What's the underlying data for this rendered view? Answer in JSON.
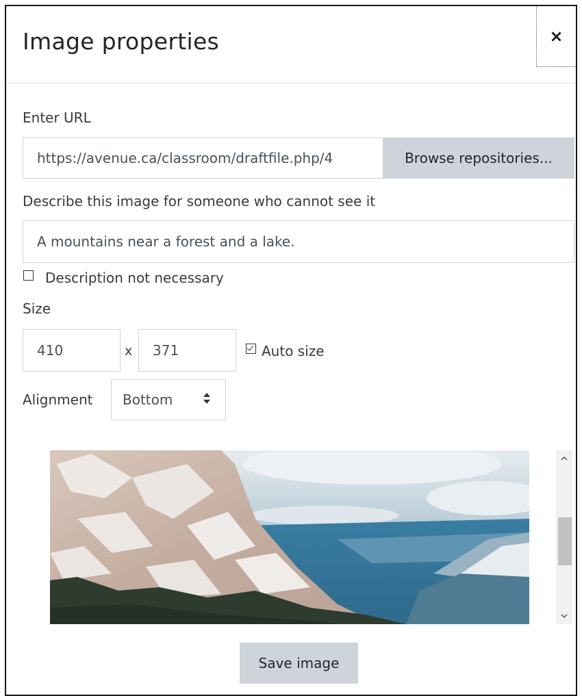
{
  "dialog": {
    "title": "Image properties",
    "close_glyph": "×"
  },
  "url_field": {
    "label": "Enter URL",
    "value": "https://avenue.ca/classroom/draftfile.php/4",
    "browse_label": "Browse repositories..."
  },
  "description": {
    "label": "Describe this image for someone who cannot see it",
    "value": "A mountains near a forest and a lake.",
    "not_necessary_label": "Description not necessary",
    "not_necessary_checked": false
  },
  "size": {
    "label": "Size",
    "width": "410",
    "separator": "x",
    "height": "371",
    "auto_size_label": "Auto size",
    "auto_size_checked": true
  },
  "alignment": {
    "label": "Alignment",
    "selected": "Bottom"
  },
  "preview": {
    "alt": "A mountains near a forest and a lake.",
    "colors": {
      "sky": "#a9c4d3",
      "lake": "#3f7ea0",
      "rock": "#c9b6a8",
      "snow": "#ece9e6",
      "forest": "#2f3d30"
    }
  },
  "save_label": "Save image",
  "colors": {
    "button_bg": "#ced4da",
    "border": "#ced4da",
    "text": "#373a3c"
  }
}
